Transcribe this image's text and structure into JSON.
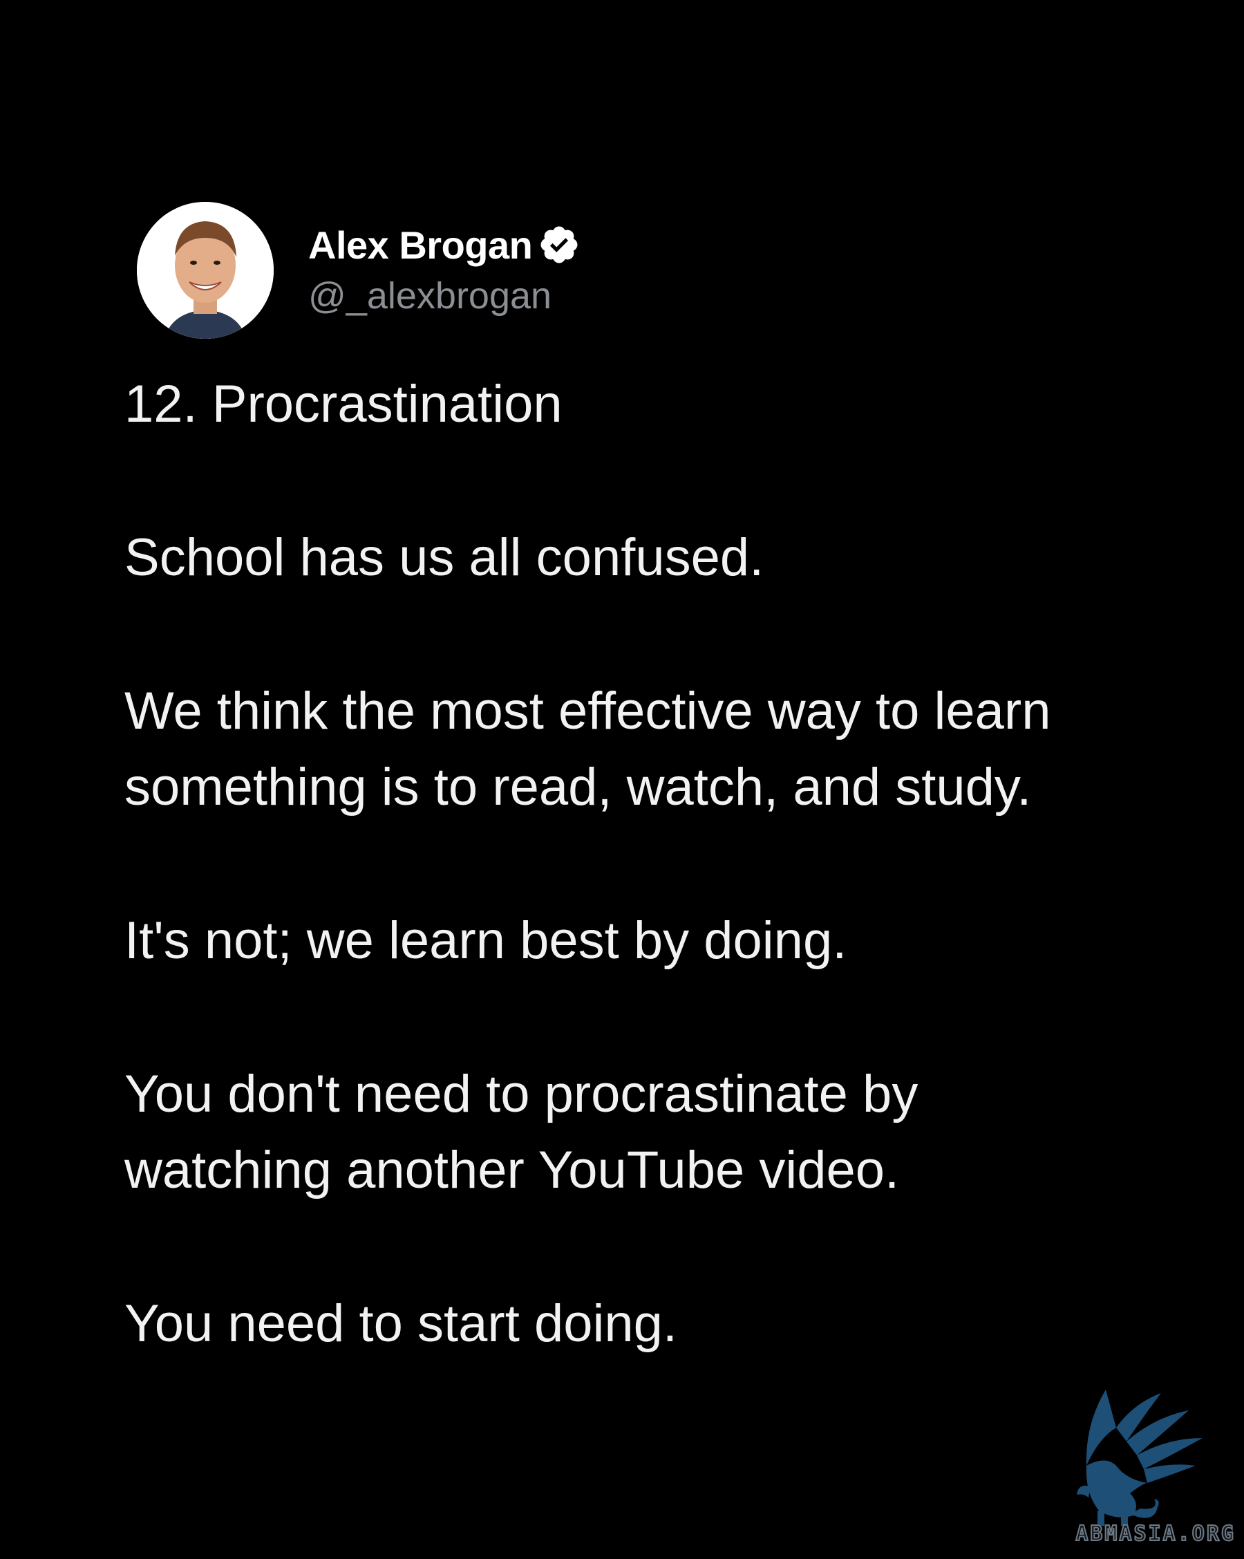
{
  "author": {
    "display_name": "Alex Brogan",
    "handle": "@_alexbrogan",
    "verified": true,
    "avatar_icon": "profile-photo-avatar"
  },
  "tweet": {
    "paragraphs": [
      "12. Procrastination",
      "School has us all confused.",
      "We think the most effective way to learn\nsomething is to read, watch, and study.",
      "It's not; we learn best by doing.",
      "You don't need to procrastinate by\nwatching another YouTube video.",
      "You need to start doing."
    ]
  },
  "watermark": {
    "text": "ABMASIA.ORG",
    "icon": "griffin-logo-icon",
    "color": "#1d4f77"
  },
  "colors": {
    "background": "#000000",
    "text": "#f2f2f2",
    "handle": "#8b8f94"
  }
}
